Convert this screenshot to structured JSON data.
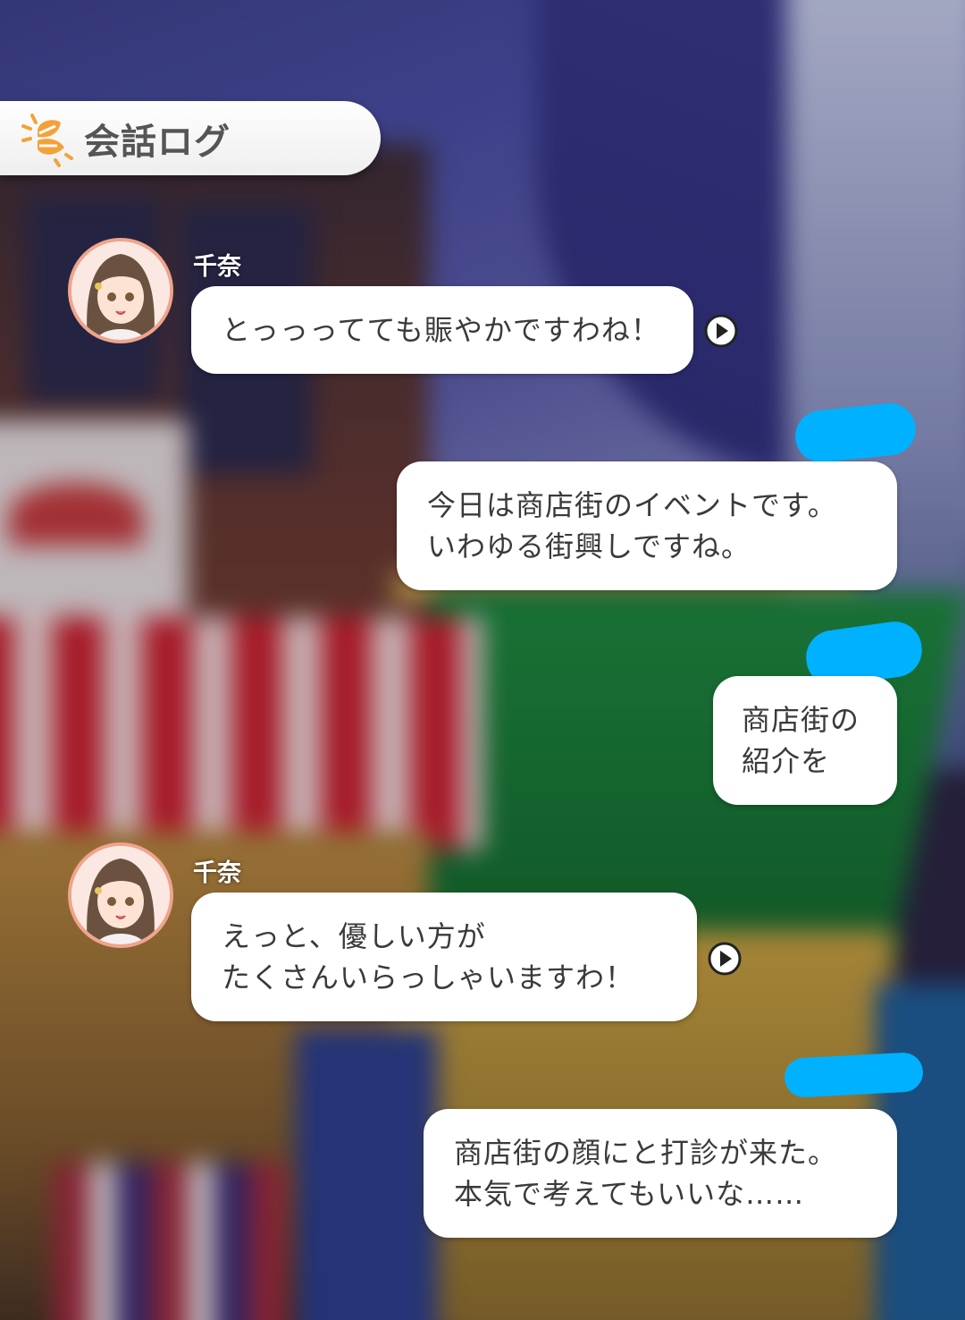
{
  "header": {
    "title": "会話ログ",
    "icon": "leaf-sun-icon"
  },
  "colors": {
    "accent": "#f3a23a",
    "bubble": "#ffffff",
    "redaction": "#00b1ff",
    "avatar_ring": "#f0a48c"
  },
  "messages": [
    {
      "speaker": "千奈",
      "lines": [
        "とっっってても賑やかですわね！"
      ],
      "has_voice": true
    },
    {
      "speaker": "",
      "lines": [
        "今日は商店街のイベントです。",
        "いわゆる街興しですね。"
      ],
      "has_voice": false
    },
    {
      "speaker": "",
      "lines": [
        "商店街の",
        "紹介を"
      ],
      "has_voice": false
    },
    {
      "speaker": "千奈",
      "lines": [
        "えっと、優しい方が",
        "たくさんいらっしゃいますわ！"
      ],
      "has_voice": true
    },
    {
      "speaker": "",
      "lines": [
        "商店街の顔にと打診が来た。",
        "本気で考えてもいいな……"
      ],
      "has_voice": false
    }
  ]
}
